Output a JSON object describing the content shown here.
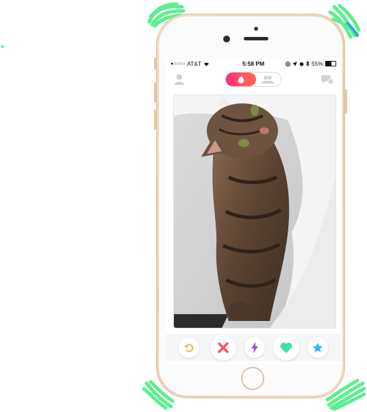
{
  "status_bar": {
    "signal_dots": "●○○○○",
    "carrier": "AT&T",
    "time": "5:58 PM",
    "battery_percent": "55%",
    "battery_level": 0.55
  },
  "header": {
    "profile_icon": "profile-icon",
    "active_tab_icon": "flame-icon",
    "inactive_tab_icon": "group-icon",
    "chat_icon": "chat-bubbles-icon"
  },
  "card": {
    "image_description_icon": "photo-cat"
  },
  "actions": [
    {
      "name": "rewind",
      "icon": "rewind-icon",
      "color": "#f5b748"
    },
    {
      "name": "nope",
      "icon": "x-icon",
      "color": "#fd5068"
    },
    {
      "name": "boost",
      "icon": "lightning-icon",
      "color": "#a347d6"
    },
    {
      "name": "like",
      "icon": "heart-icon",
      "color": "#3ee0a2"
    },
    {
      "name": "super-like",
      "icon": "star-icon",
      "color": "#2db4f4"
    }
  ],
  "colors": {
    "brand_gradient_start": "#fd297b",
    "brand_gradient_end": "#ff655b",
    "scribble": "#5bef8e",
    "phone_gold": "#f1d9bf"
  }
}
